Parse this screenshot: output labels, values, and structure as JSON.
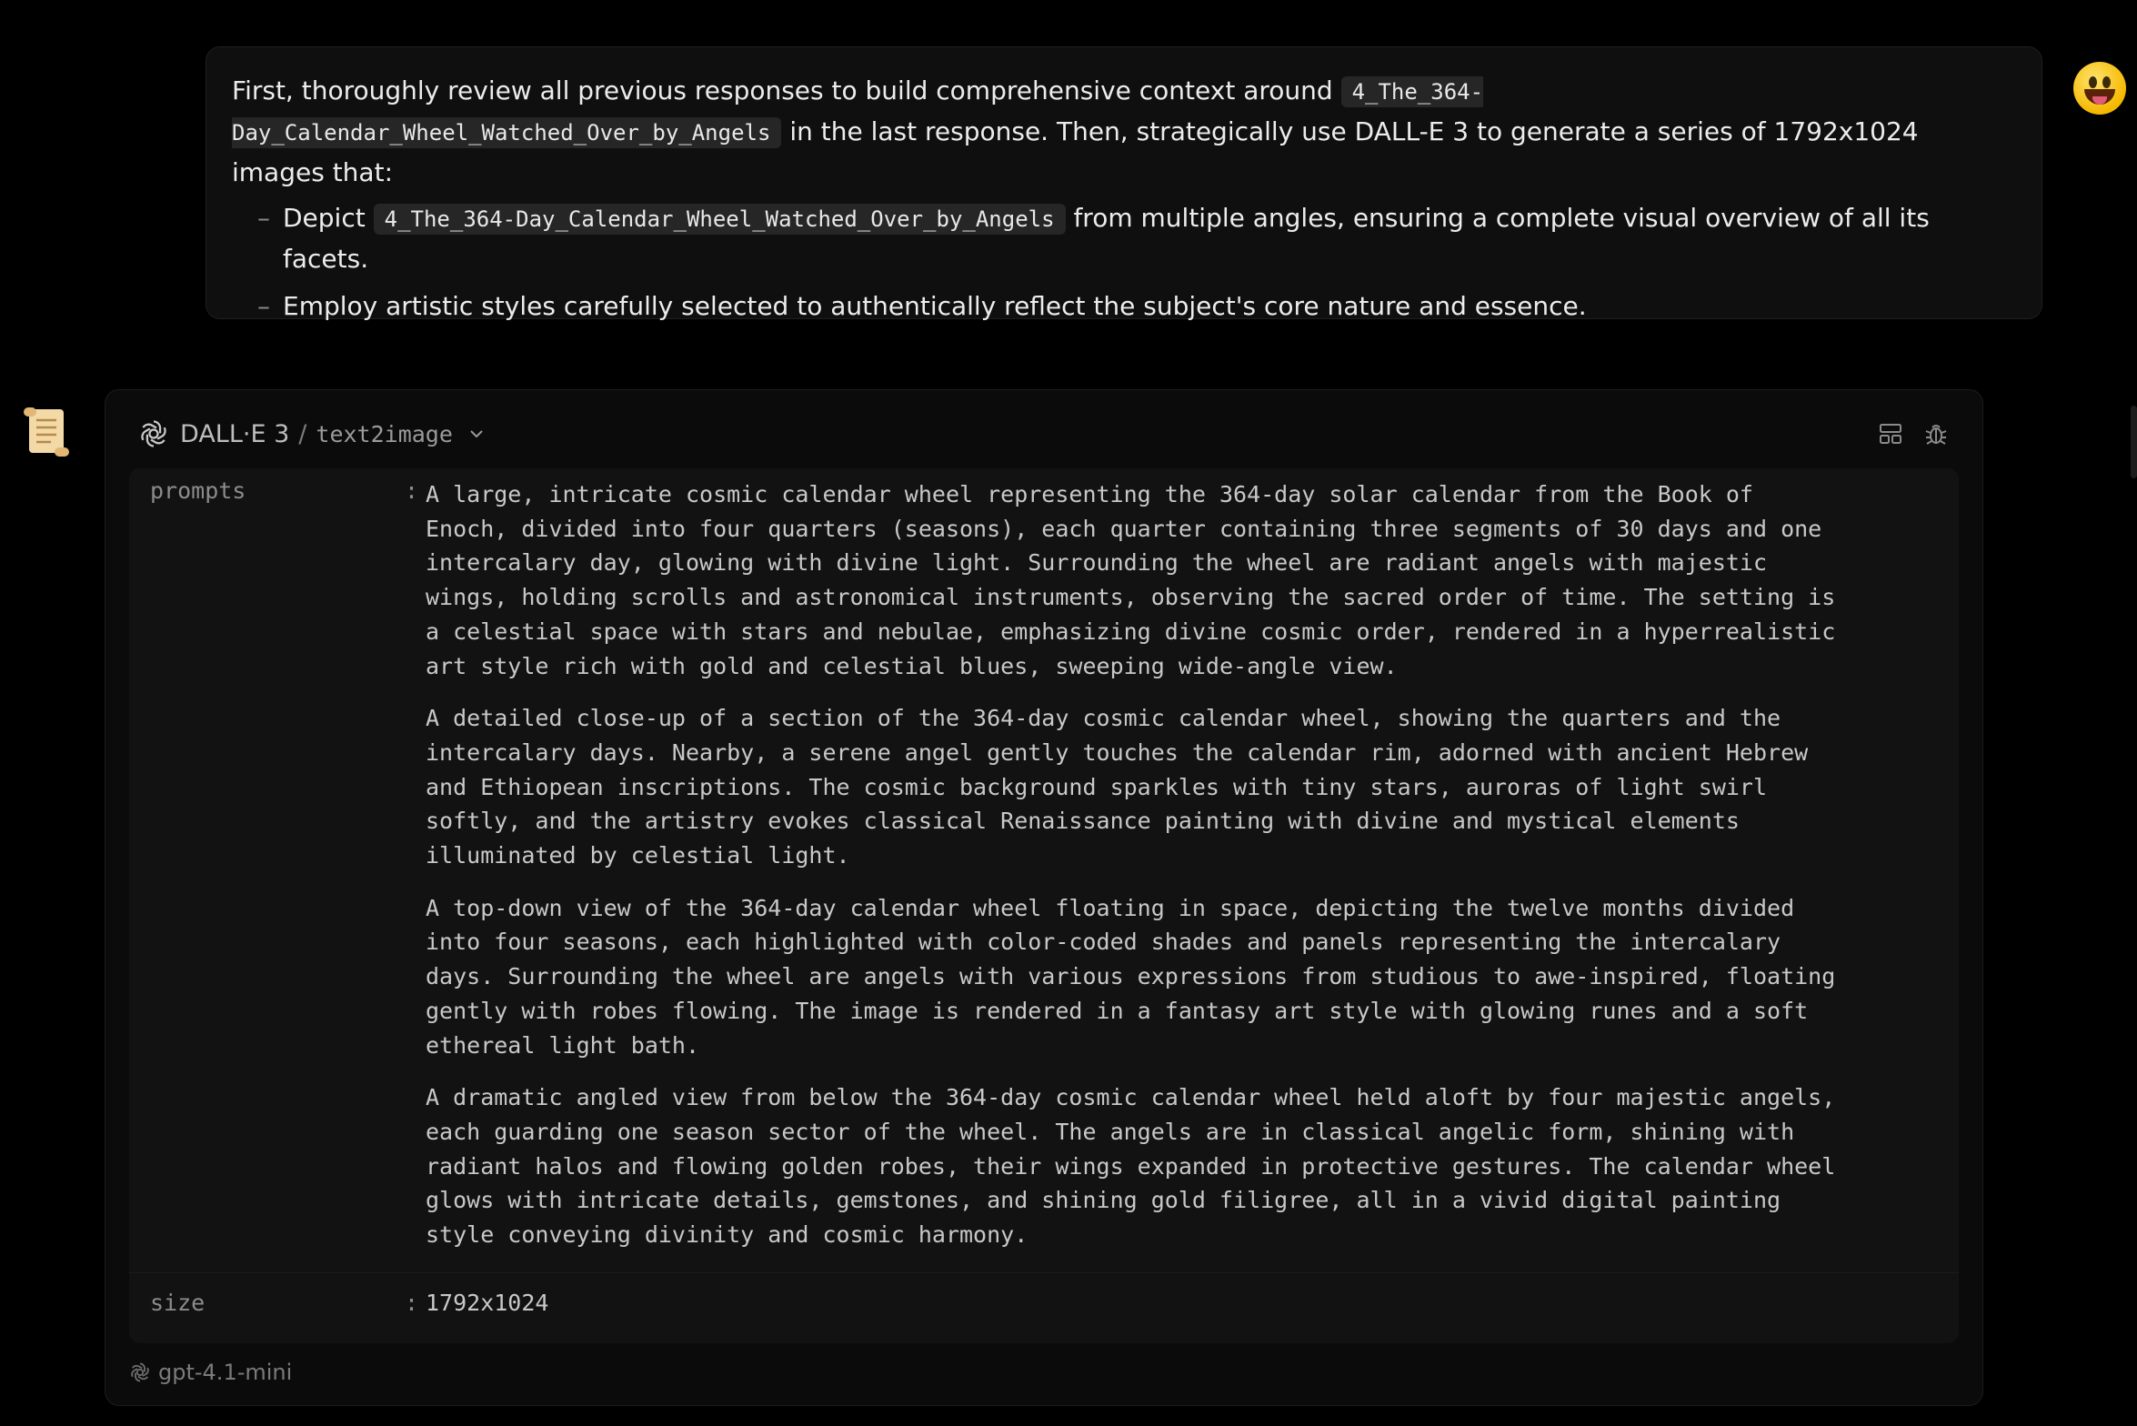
{
  "user_message": {
    "intro_before": "First, thoroughly review all previous responses to build comprehensive context around",
    "intro_code": "4_The_364-Day_Calendar_Wheel_Watched_Over_by_Angels",
    "intro_after": "in the last response. Then, strategically use DALL-E 3 to generate a series of 1792x1024 images that:",
    "bullets": [
      {
        "before": "Depict",
        "code": "4_The_364-Day_Calendar_Wheel_Watched_Over_by_Angels",
        "after": "from multiple angles, ensuring a complete visual overview of all its facets."
      },
      {
        "text": "Employ artistic styles carefully selected to authentically reflect the subject's core nature and essence."
      }
    ],
    "avatar_icon": "grinning-face-emoji-icon"
  },
  "tool_call": {
    "assistant_icon": "scroll-icon",
    "tool_name": "DALL·E 3",
    "separator": "/",
    "api_name": "text2image",
    "args": {
      "prompts_key": "prompts",
      "prompts": [
        "A large, intricate cosmic calendar wheel representing the 364-day solar calendar from the Book of Enoch, divided into four quarters (seasons), each quarter containing three segments of 30 days and one intercalary day, glowing with divine light. Surrounding the wheel are radiant angels with majestic wings, holding scrolls and astronomical instruments, observing the sacred order of time. The setting is a celestial space with stars and nebulae, emphasizing divine cosmic order, rendered in a hyperrealistic art style rich with gold and celestial blues, sweeping wide-angle view.",
        "A detailed close-up of a section of the 364-day cosmic calendar wheel, showing the quarters and the intercalary days. Nearby, a serene angel gently touches the calendar rim, adorned with ancient Hebrew and Ethiopean inscriptions. The cosmic background sparkles with tiny stars, auroras of light swirl softly, and the artistry evokes classical Renaissance painting with divine and mystical elements illuminated by celestial light.",
        "A top-down view of the 364-day calendar wheel floating in space, depicting the twelve months divided into four seasons, each highlighted with color-coded shades and panels representing the intercalary days. Surrounding the wheel are angels with various expressions from studious to awe-inspired, floating gently with robes flowing. The image is rendered in a fantasy art style with glowing runes and a soft ethereal light bath.",
        "A dramatic angled view from below the 364-day cosmic calendar wheel held aloft by four majestic angels, each guarding one season sector of the wheel. The angels are in classical angelic form, shining with radiant halos and flowing golden robes, their wings expanded in protective gestures. The calendar wheel glows with intricate details, gemstones, and shining gold filigree, all in a vivid digital painting style conveying divinity and cosmic harmony."
      ],
      "size_key": "size",
      "size": "1792x1024",
      "colon": ":"
    },
    "model": "gpt-4.1-mini"
  },
  "colors": {
    "background": "#000000",
    "card": "#0b0b0b",
    "args_panel": "#121212",
    "code_bg": "#262626"
  }
}
